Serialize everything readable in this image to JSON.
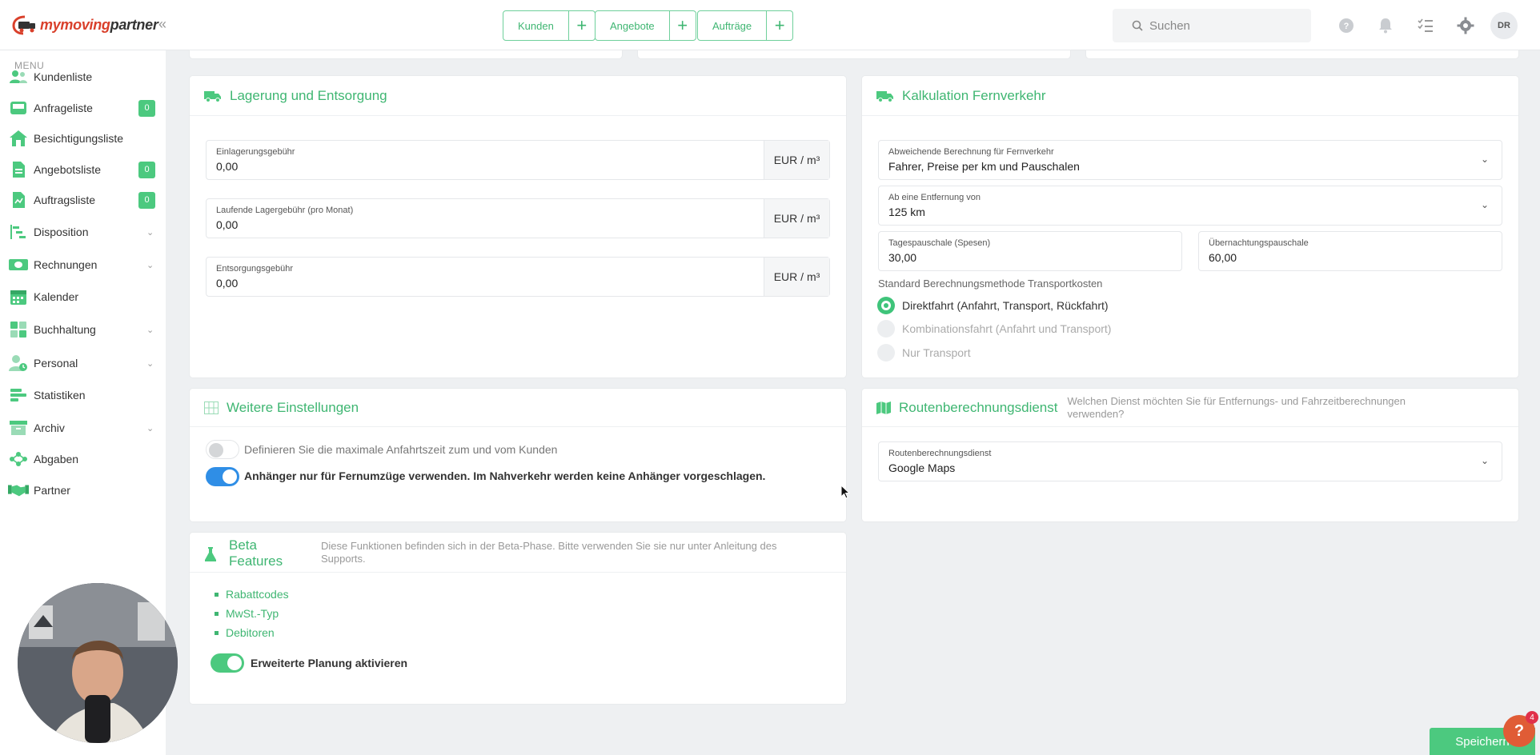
{
  "brand": {
    "name_part1": "mymoving",
    "name_part2": "partner"
  },
  "quick_actions": [
    {
      "label": "Kunden"
    },
    {
      "label": "Angebote"
    },
    {
      "label": "Aufträge"
    }
  ],
  "search": {
    "placeholder": "Suchen"
  },
  "user": {
    "initials": "DR"
  },
  "sidebar": {
    "menu_label": "MENU",
    "items": [
      {
        "label": "Kundenliste",
        "icon": "users-icon"
      },
      {
        "label": "Anfrageliste",
        "icon": "inbox-icon",
        "badge": "0"
      },
      {
        "label": "Besichtigungsliste",
        "icon": "house-icon"
      },
      {
        "label": "Angebotsliste",
        "icon": "document-icon",
        "badge": "0"
      },
      {
        "label": "Auftragsliste",
        "icon": "clipboard-icon",
        "badge": "0"
      },
      {
        "label": "Disposition",
        "icon": "gantt-icon"
      },
      {
        "label": "Rechnungen",
        "icon": "cash-icon"
      },
      {
        "label": "Kalender",
        "icon": "calendar-icon"
      },
      {
        "label": "Buchhaltung",
        "icon": "grid-icon"
      },
      {
        "label": "Personal",
        "icon": "person-clock-icon"
      },
      {
        "label": "Statistiken",
        "icon": "bars-icon"
      },
      {
        "label": "Archiv",
        "icon": "archive-icon"
      },
      {
        "label": "Abgaben",
        "icon": "network-icon"
      },
      {
        "label": "Partner",
        "icon": "handshake-icon"
      }
    ]
  },
  "storage": {
    "title": "Lagerung und Entsorgung",
    "fields": [
      {
        "label": "Einlagerungsgebühr",
        "value": "0,00",
        "unit": "EUR / m³"
      },
      {
        "label": "Laufende Lagergebühr (pro Monat)",
        "value": "0,00",
        "unit": "EUR / m³"
      },
      {
        "label": "Entsorgungsgebühr",
        "value": "0,00",
        "unit": "EUR / m³"
      }
    ]
  },
  "longdistance": {
    "title": "Kalkulation Fernverkehr",
    "calc_method": {
      "label": "Abweichende Berechnung für Fernverkehr",
      "value": "Fahrer, Preise per km und Pauschalen"
    },
    "distance": {
      "label": "Ab eine Entfernung von",
      "value": "125 km"
    },
    "daily_rate": {
      "label": "Tagespauschale (Spesen)",
      "value": "30,00"
    },
    "overnight_rate": {
      "label": "Übernachtungspauschale",
      "value": "60,00"
    },
    "transport_method_label": "Standard Berechnungsmethode Transportkosten",
    "options": [
      {
        "label": "Direktfahrt (Anfahrt, Transport, Rückfahrt)"
      },
      {
        "label": "Kombinationsfahrt (Anfahrt und Transport)"
      },
      {
        "label": "Nur Transport"
      }
    ]
  },
  "further": {
    "title": "Weitere Einstellungen",
    "toggle1": "Definieren Sie die maximale Anfahrtszeit zum und vom Kunden",
    "toggle2": "Anhänger nur für Fernumzüge verwenden. Im Nahverkehr werden keine Anhänger vorgeschlagen."
  },
  "routing": {
    "title": "Routenberechnungsdienst",
    "hint_line1": "Welchen Dienst möchten Sie für Entfernungs- und Fahrzeitberechnungen",
    "hint_line2": "verwenden?",
    "field": {
      "label": "Routenberechnungsdienst",
      "value": "Google Maps"
    }
  },
  "beta": {
    "title_line1": "Beta",
    "title_line2": "Features",
    "hint_line1": "Diese Funktionen befinden sich in der Beta-Phase. Bitte verwenden Sie sie nur unter Anleitung des",
    "hint_line2": "Supports.",
    "items": [
      "Rabattcodes",
      "MwSt.-Typ",
      "Debitoren"
    ],
    "toggle": "Erweiterte Planung aktivieren"
  },
  "save_label": "Speichern",
  "help": {
    "label": "?",
    "count": "4"
  },
  "colors": {
    "accent": "#3fb672",
    "brand_red": "#d9402b",
    "toggle_blue": "#2f8ee6"
  }
}
